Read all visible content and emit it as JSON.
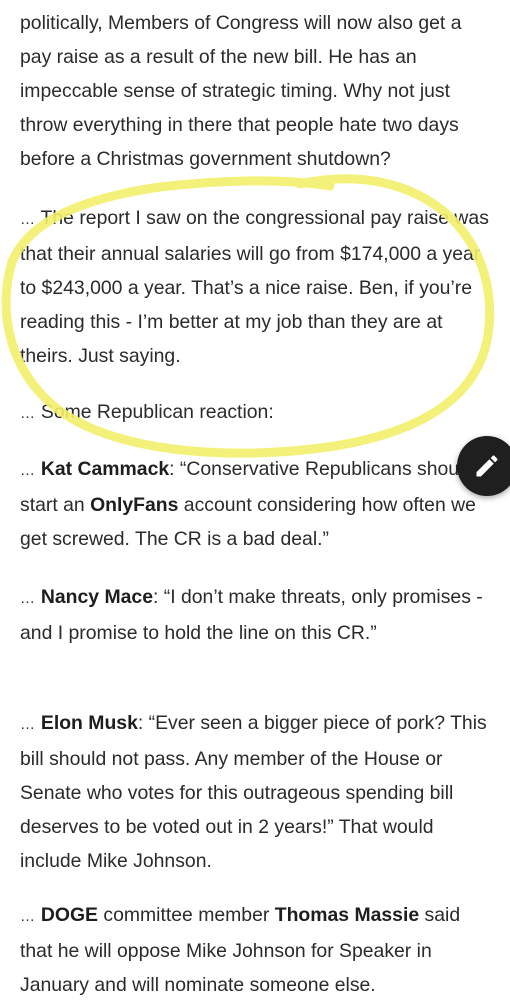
{
  "article": {
    "p1": {
      "text": "politically, Members of Congress will now also get a pay raise as a result of the new bill. He has an impeccable sense of strategic timing. Why not just throw everything in there that people hate two days before a Christmas government shutdown?"
    },
    "p2": {
      "ellipsis": "…",
      "text": " The report I saw on the congressional pay raise was that their annual salaries will go from $174,000 a year to $243,000 a year. That’s a nice raise. Ben, if you’re reading this - I’m better at my job than they are at theirs. Just saying."
    },
    "p3": {
      "ellipsis": "…",
      "text": " Some Republican reaction:"
    },
    "p4": {
      "ellipsis": "…",
      "speaker": "Kat Cammack",
      "text_a": ": “Conservative Republicans should start an ",
      "bold_word": "OnlyFans",
      "text_b": " account considering how often we get screwed. The CR is a bad deal.”"
    },
    "p5": {
      "ellipsis": "…",
      "speaker": "Nancy Mace",
      "text": ": “I don’t make threats, only promises - and I promise to hold the line on this CR.”"
    },
    "p6": {
      "ellipsis": "…",
      "speaker": "Elon Musk",
      "text": ": “Ever seen a bigger piece of pork? This bill should not pass. Any member of the House or Senate who votes for this outrageous spending bill deserves to be voted out in 2 years!” That would include Mike Johnson."
    },
    "p7": {
      "ellipsis": "…",
      "org": "DOGE",
      "text_a": " committee member ",
      "member": "Thomas Massie",
      "text_b": " said that he will oppose Mike Johnson for Speaker in January and will nominate someone else."
    }
  },
  "annotation": {
    "highlight_color": "#f2ef6c",
    "shape": "hand-drawn circle"
  },
  "fab": {
    "icon": "pencil-icon",
    "background": "#1f1f1f"
  }
}
